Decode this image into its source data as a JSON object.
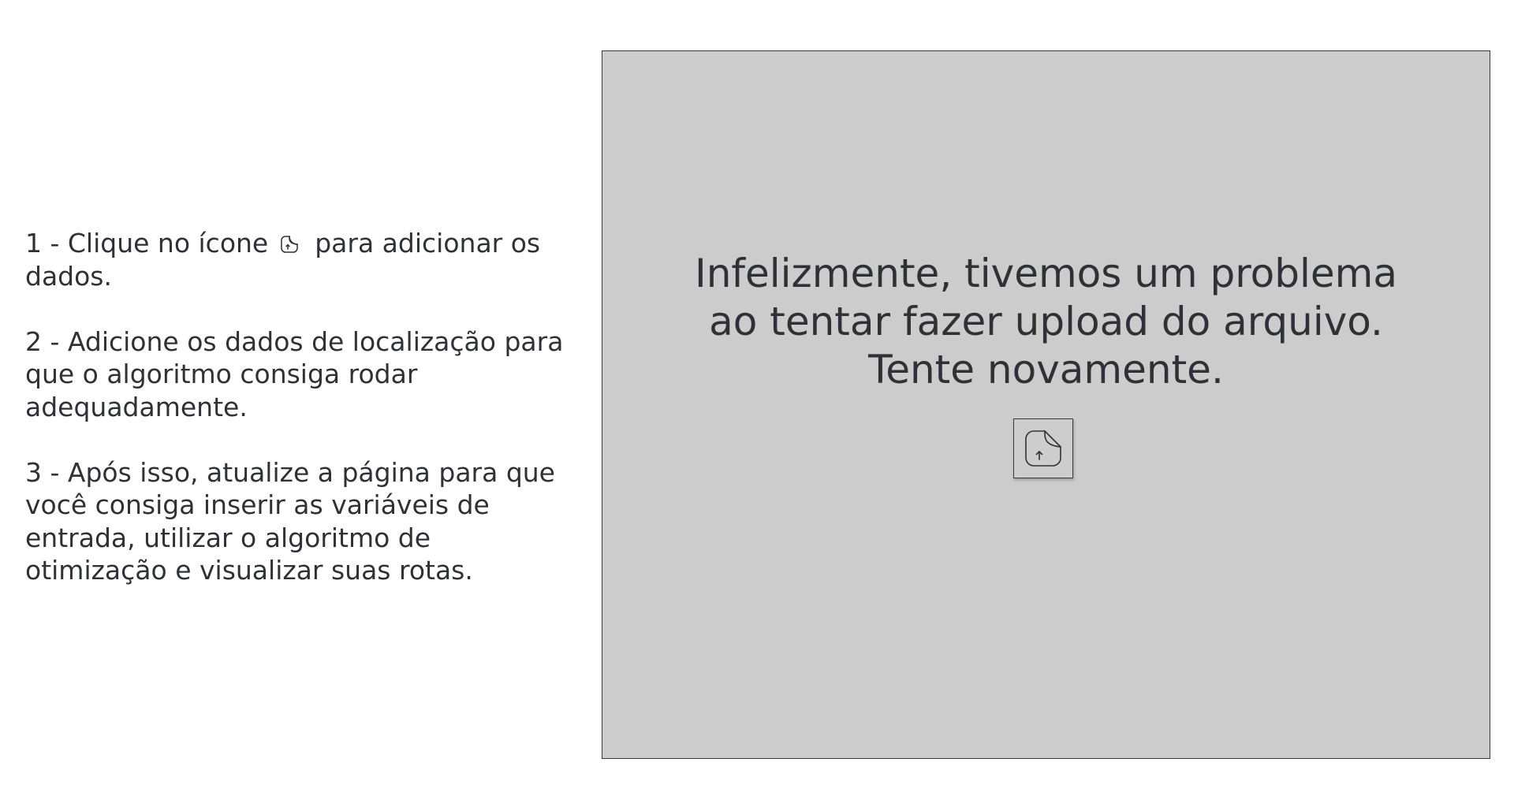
{
  "instructions": {
    "step1_before": "1 - Clique no ícone",
    "step1_after": "para adicionar os dados.",
    "step1_icon": "file-upload-icon",
    "step2": "2 - Adicione os dados de localização para que o algoritmo consiga rodar adequadamente.",
    "step3": "3 - Após isso, atualize a página para que você consiga inserir as variáveis de entrada, utilizar o algoritmo de otimização e visualizar suas rotas."
  },
  "panel": {
    "error_message": "Infelizmente, tivemos um problema ao tentar fazer upload do arquivo. Tente novamente.",
    "upload_button_icon": "file-upload-icon",
    "background_color": "#cccccc"
  }
}
